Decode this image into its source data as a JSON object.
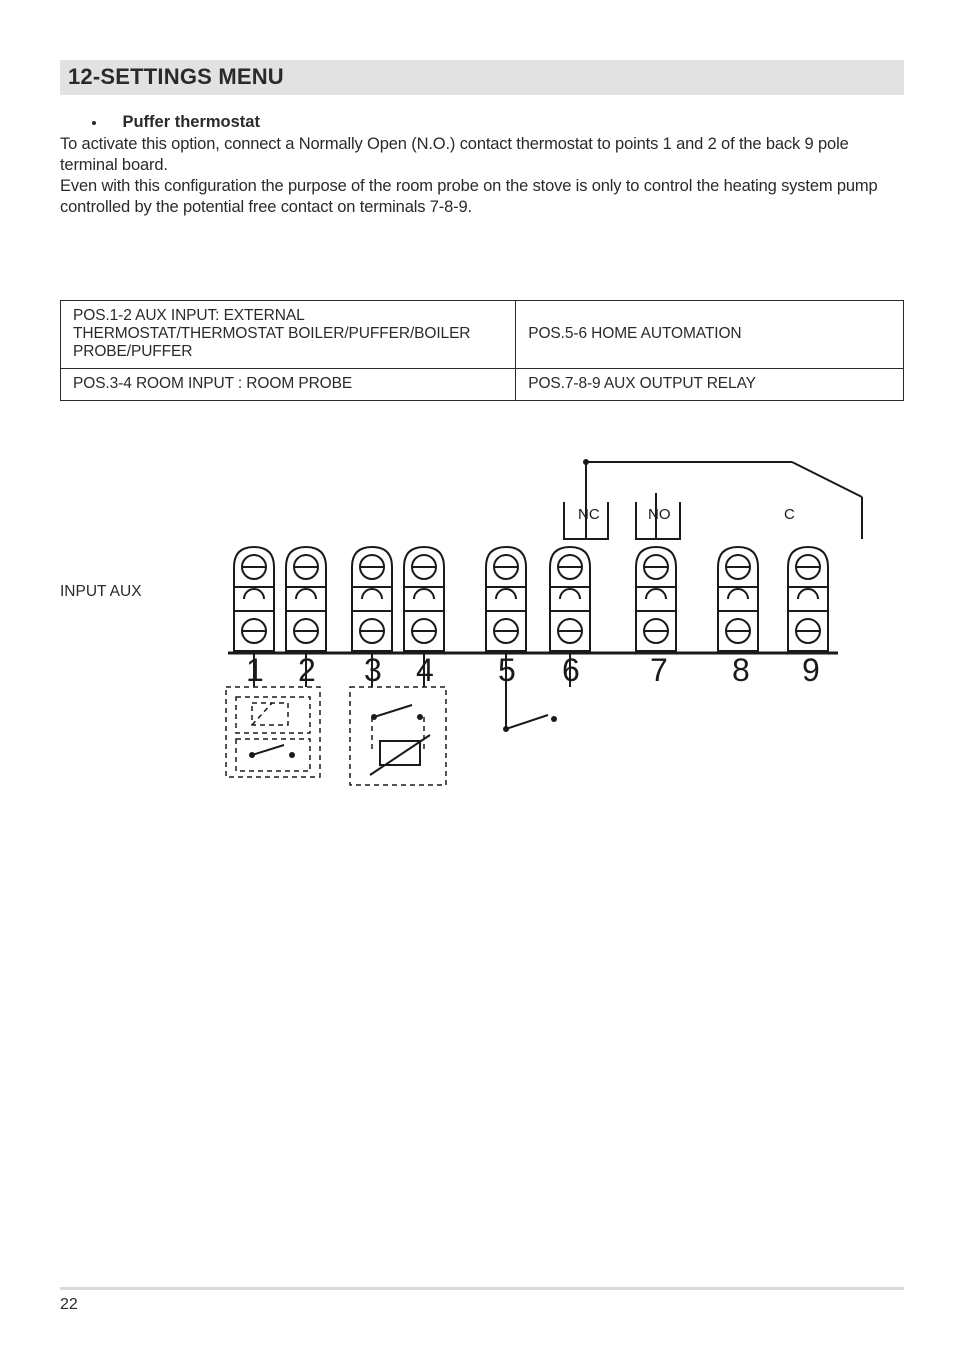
{
  "title": "12-SETTINGS MENU",
  "bullet_label": "Puffer thermostat",
  "para1": "To activate this option, connect a Normally Open (N.O.) contact thermostat to points 1 and 2 of the back 9 pole terminal board.",
  "para2": "Even with this configuration the purpose of the room probe on the stove is only to control the heating system pump controlled by the potential free contact on terminals 7-8-9.",
  "table": {
    "r1c1": "POS.1-2 AUX INPUT: EXTERNAL THERMOSTAT/THERMOSTAT BOILER/PUFFER/BOILER PROBE/PUFFER",
    "r1c2": "POS.5-6 HOME AUTOMATION",
    "r2c1": "POS.3-4 ROOM INPUT : ROOM PROBE",
    "r2c2": "POS.7-8-9 AUX OUTPUT RELAY"
  },
  "diagram": {
    "side_label": "INPUT AUX",
    "nc": "NC",
    "no": "NO",
    "c": "C",
    "n1": "1",
    "n2": "2",
    "n3": "3",
    "n4": "4",
    "n5": "5",
    "n6": "6",
    "n7": "7",
    "n8": "8",
    "n9": "9"
  },
  "page_number": "22"
}
